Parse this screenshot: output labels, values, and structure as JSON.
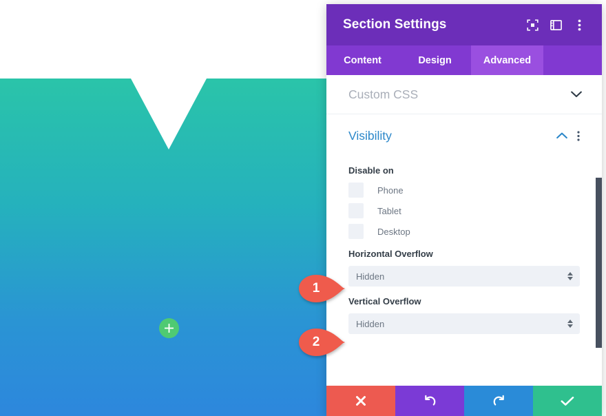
{
  "canvas": {
    "add_section_button": "add-section",
    "hero_gradient_top": "#2ac4a9",
    "hero_gradient_bottom": "#2d87dd"
  },
  "callouts": [
    {
      "number": "1",
      "color": "#ef5b4c"
    },
    {
      "number": "2",
      "color": "#ef5b4c"
    }
  ],
  "modal": {
    "title": "Section Settings",
    "header_color": "#6c2eb9",
    "header_icons": [
      {
        "name": "focus-icon"
      },
      {
        "name": "layout-panel-icon"
      },
      {
        "name": "more-vertical-icon"
      }
    ],
    "tabs": [
      {
        "label": "Content",
        "active": false
      },
      {
        "label": "Design",
        "active": false
      },
      {
        "label": "Advanced",
        "active": true
      }
    ],
    "sections": {
      "custom_css": {
        "label": "Custom CSS",
        "state": "collapsed"
      },
      "visibility": {
        "label": "Visibility",
        "state": "expanded"
      }
    },
    "visibility": {
      "disable_on_label": "Disable on",
      "checkboxes": [
        {
          "label": "Phone",
          "checked": false
        },
        {
          "label": "Tablet",
          "checked": false
        },
        {
          "label": "Desktop",
          "checked": false
        }
      ],
      "horizontal_overflow": {
        "label": "Horizontal Overflow",
        "value": "Hidden"
      },
      "vertical_overflow": {
        "label": "Vertical Overflow",
        "value": "Hidden"
      }
    },
    "actions": [
      {
        "name": "cancel",
        "icon": "close-icon",
        "color": "#ed5a50"
      },
      {
        "name": "undo",
        "icon": "undo-icon",
        "color": "#7b3ad6"
      },
      {
        "name": "redo",
        "icon": "redo-icon",
        "color": "#2a8bd8"
      },
      {
        "name": "save",
        "icon": "checkmark-icon",
        "color": "#2fc08e"
      }
    ]
  }
}
